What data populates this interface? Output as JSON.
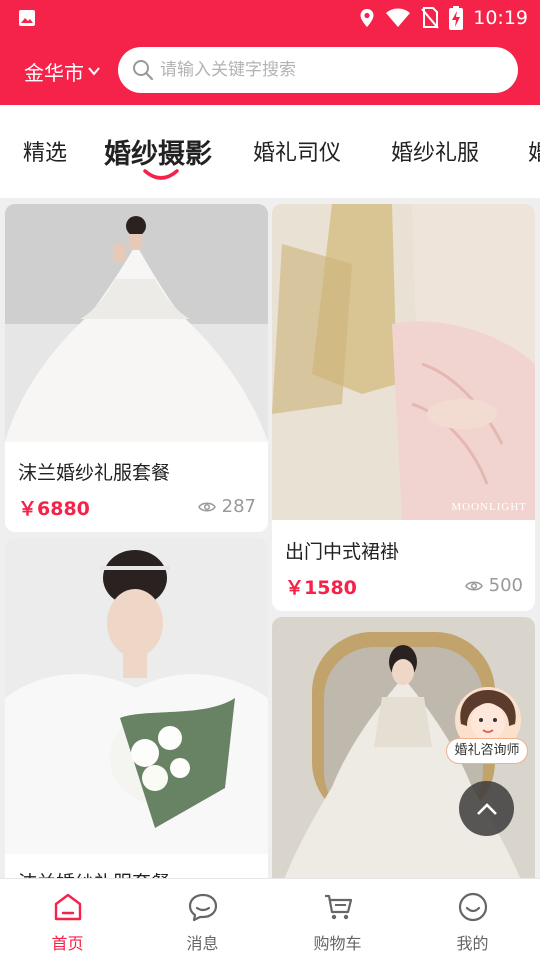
{
  "status_bar": {
    "time": "10:19"
  },
  "header": {
    "city": "金华市",
    "search_placeholder": "请输入关键字搜索"
  },
  "tabs": [
    {
      "label": "精选"
    },
    {
      "label": "婚纱摄影"
    },
    {
      "label": "婚礼司仪"
    },
    {
      "label": "婚纱礼服"
    },
    {
      "label": "婚"
    }
  ],
  "cards": [
    {
      "title": "沫兰婚纱礼服套餐",
      "price": "￥6880",
      "views": "287"
    },
    {
      "title": "出门中式裙褂",
      "price": "￥1580",
      "views": "500"
    },
    {
      "title": "沫兰婚纱礼服套餐",
      "price": "",
      "views": ""
    },
    {
      "title": "",
      "price": "",
      "views": ""
    }
  ],
  "watermark": "MOONLIGHT",
  "advisor": {
    "label": "婚礼咨询师"
  },
  "bottom_nav": [
    {
      "label": "首页",
      "icon": "home-icon",
      "active": true
    },
    {
      "label": "消息",
      "icon": "message-icon",
      "active": false
    },
    {
      "label": "购物车",
      "icon": "cart-icon",
      "active": false
    },
    {
      "label": "我的",
      "icon": "profile-icon",
      "active": false
    }
  ],
  "colors": {
    "accent": "#f5224a",
    "price": "#f5224a",
    "background": "#efefef"
  }
}
